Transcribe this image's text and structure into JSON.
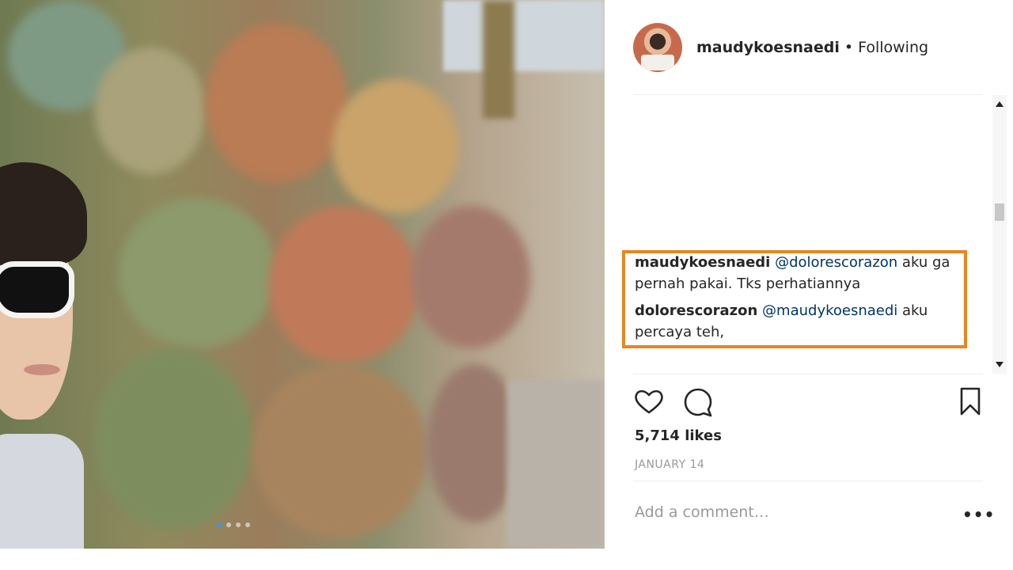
{
  "post": {
    "username": "maudykoesnaedi",
    "separator": "•",
    "follow_status": "Following",
    "carousel_dots": 4,
    "active_dot": 1
  },
  "comments": [
    {
      "user": "maudykoesnaedi",
      "mention": "@dolorescorazon",
      "text": " aku ga pernah pakai. Tks perhatiannya"
    },
    {
      "user": "dolorescorazon",
      "mention": "@maudykoesnaedi",
      "text": " aku percaya teh,"
    }
  ],
  "actions": {
    "like_icon": "heart-icon",
    "comment_icon": "comment-bubble-icon",
    "save_icon": "bookmark-icon"
  },
  "likes": "5,714 likes",
  "date": "JANUARY 14",
  "add_comment": {
    "placeholder": "Add a comment…"
  },
  "more_label": "•••",
  "colors": {
    "highlight": "#e8861f",
    "mention": "#003569",
    "meta_gray": "#999999"
  }
}
